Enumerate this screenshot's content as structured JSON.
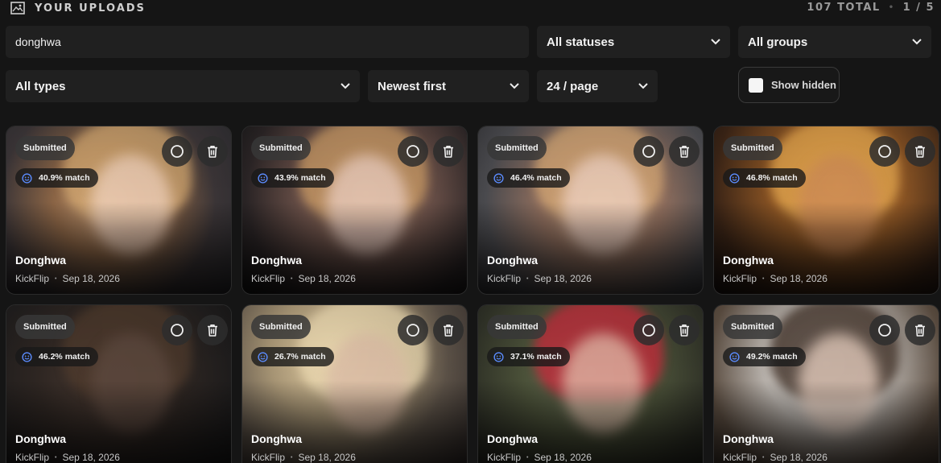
{
  "header": {
    "title": "YOUR UPLOADS",
    "total": "107 TOTAL",
    "separator": "•",
    "pagination": "1 / 5"
  },
  "filters": {
    "search_value": "donghwa",
    "status": "All statuses",
    "group": "All groups",
    "type": "All types",
    "sort": "Newest first",
    "per_page": "24 / page",
    "show_hidden": "Show hidden"
  },
  "cards": [
    {
      "status": "Submitted",
      "match": "40.9% match",
      "name": "Donghwa",
      "group": "KickFlip",
      "date": "Sep 18, 2026",
      "sep": "•"
    },
    {
      "status": "Submitted",
      "match": "43.9% match",
      "name": "Donghwa",
      "group": "KickFlip",
      "date": "Sep 18, 2026",
      "sep": "•"
    },
    {
      "status": "Submitted",
      "match": "46.4% match",
      "name": "Donghwa",
      "group": "KickFlip",
      "date": "Sep 18, 2026",
      "sep": "•"
    },
    {
      "status": "Submitted",
      "match": "46.8% match",
      "name": "Donghwa",
      "group": "KickFlip",
      "date": "Sep 18, 2026",
      "sep": "•"
    },
    {
      "status": "Submitted",
      "match": "46.2% match",
      "name": "Donghwa",
      "group": "KickFlip",
      "date": "Sep 18, 2026",
      "sep": "•"
    },
    {
      "status": "Submitted",
      "match": "26.7% match",
      "name": "Donghwa",
      "group": "KickFlip",
      "date": "Sep 18, 2026",
      "sep": "•"
    },
    {
      "status": "Submitted",
      "match": "37.1% match",
      "name": "Donghwa",
      "group": "KickFlip",
      "date": "Sep 18, 2026",
      "sep": "•"
    },
    {
      "status": "Submitted",
      "match": "49.2% match",
      "name": "Donghwa",
      "group": "KickFlip",
      "date": "Sep 18, 2026",
      "sep": "•"
    }
  ],
  "colors": {
    "background": "#151515",
    "control": "#202020",
    "match_icon": "#5b8cff"
  },
  "icons": {
    "title": "gallery-icon",
    "dropdown": "chevron-down-icon",
    "select": "circle-select-icon",
    "delete": "trash-icon",
    "match": "smiley-face-icon"
  }
}
